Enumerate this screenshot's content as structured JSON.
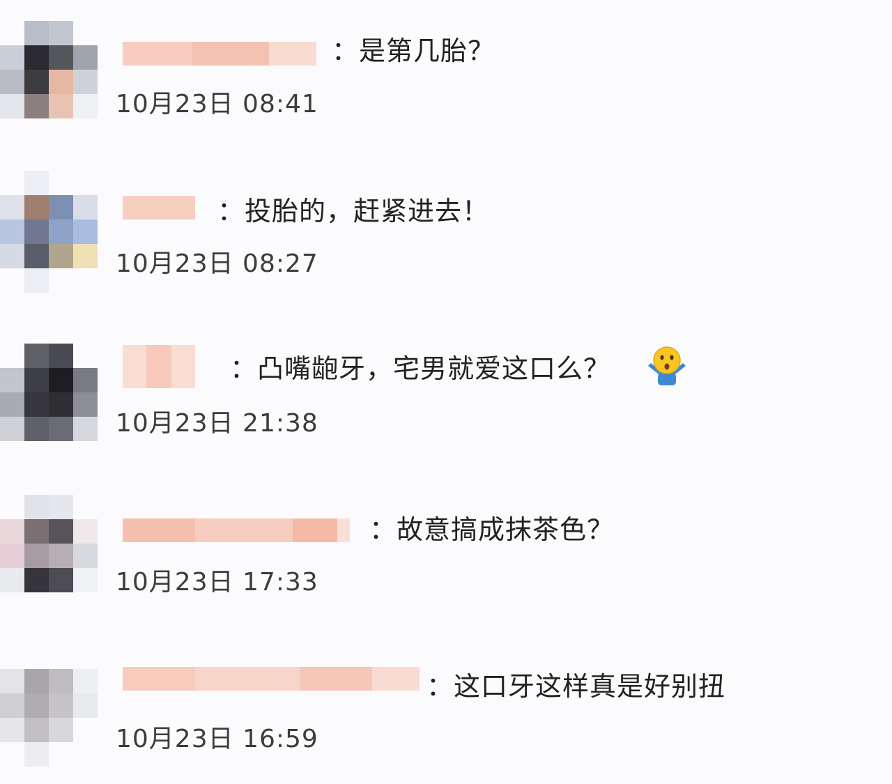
{
  "comments": [
    {
      "text": "：是第几胎？",
      "time": "10月23日 08:41"
    },
    {
      "text": "：投胎的，赶紧进去！",
      "time": "10月23日 08:27"
    },
    {
      "text": "：凸嘴龅牙，宅男就爱这口么？",
      "time": "10月23日 21:38",
      "emoji": "shrug-emoji"
    },
    {
      "text": "：故意搞成抹茶色？",
      "time": "10月23日 17:33"
    },
    {
      "text": "：这口牙这样真是好别扭",
      "time": "10月23日 16:59"
    }
  ]
}
